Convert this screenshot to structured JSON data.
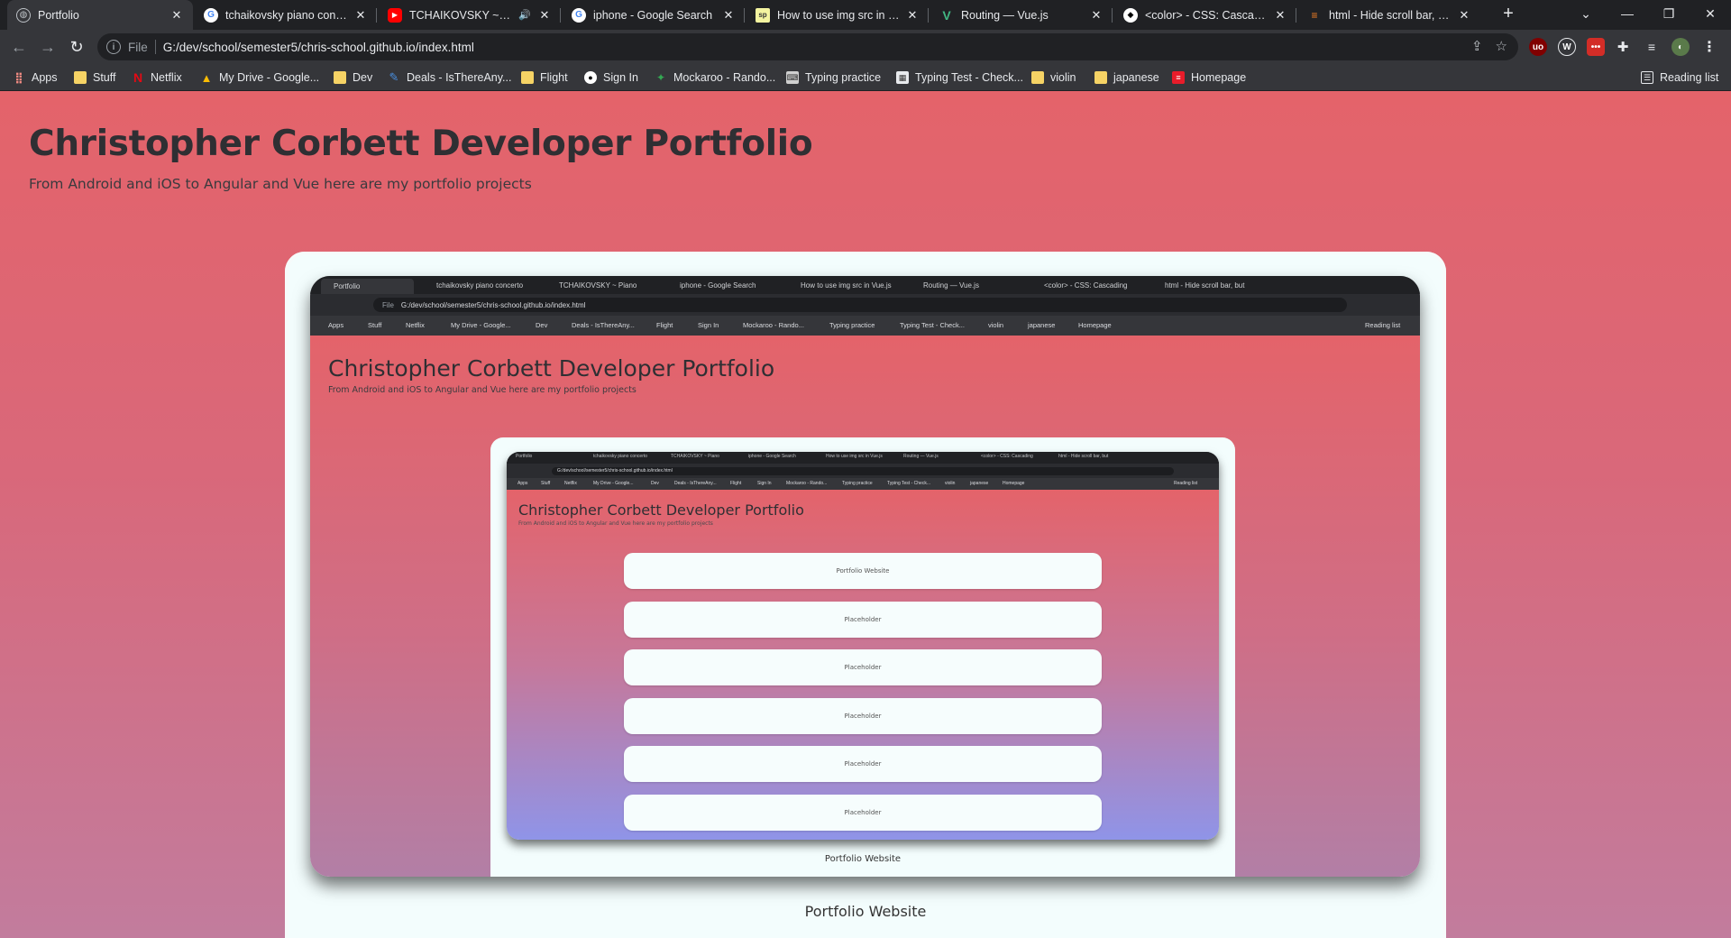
{
  "browser": {
    "tabs": [
      {
        "title": "Portfolio",
        "icon": "globe-icon",
        "active": true
      },
      {
        "title": "tchaikovsky piano concerto",
        "icon": "google-icon"
      },
      {
        "title": "TCHAIKOVSKY ~ Piano",
        "icon": "youtube-icon",
        "audio": true
      },
      {
        "title": "iphone - Google Search",
        "icon": "google-icon"
      },
      {
        "title": "How to use img src in Vue.js",
        "icon": "sitepoint-icon"
      },
      {
        "title": "Routing — Vue.js",
        "icon": "vue-icon"
      },
      {
        "title": "<color> - CSS: Cascading",
        "icon": "mdn-icon"
      },
      {
        "title": "html - Hide scroll bar, but",
        "icon": "stackoverflow-icon"
      }
    ],
    "new_tab_label": "+",
    "address": {
      "scheme_label": "File",
      "url": "G:/dev/school/semester5/chris-school.github.io/index.html"
    },
    "bookmarks": [
      {
        "label": "Apps",
        "icon": "apps-grid-icon"
      },
      {
        "label": "Stuff",
        "icon": "folder-icon"
      },
      {
        "label": "Netflix",
        "icon": "netflix-icon"
      },
      {
        "label": "My Drive - Google...",
        "icon": "google-drive-icon"
      },
      {
        "label": "Dev",
        "icon": "folder-icon"
      },
      {
        "label": "Deals - IsThereAny...",
        "icon": "deals-icon"
      },
      {
        "label": "Flight",
        "icon": "folder-icon"
      },
      {
        "label": "Sign In",
        "icon": "github-icon"
      },
      {
        "label": "Mockaroo - Rando...",
        "icon": "mockaroo-icon"
      },
      {
        "label": "Typing practice",
        "icon": "typing-icon"
      },
      {
        "label": "Typing Test - Check...",
        "icon": "keyboard-icon"
      },
      {
        "label": "violin",
        "icon": "folder-icon"
      },
      {
        "label": "japanese",
        "icon": "folder-icon"
      },
      {
        "label": "Homepage",
        "icon": "homepage-icon"
      }
    ],
    "reading_list_label": "Reading list"
  },
  "page": {
    "title": "Christopher Corbett Developer Portfolio",
    "subtitle": "From Android and iOS to Angular and Vue here are my portfolio projects",
    "project_card": {
      "caption": "Portfolio Website",
      "screenshot": {
        "title": "Christopher Corbett Developer Portfolio",
        "subtitle": "From Android and iOS to Angular and Vue here are my portfolio projects",
        "caption": "Portfolio Website",
        "inner_buttons": [
          "Portfolio Website",
          "Placeholder",
          "Placeholder",
          "Placeholder",
          "Placeholder",
          "Placeholder"
        ]
      }
    }
  },
  "colors": {
    "page_gradient_top": "#e4636a",
    "page_gradient_bottom": "#c27c9d",
    "card_background": "#f3fdfd",
    "chrome_dark": "#202124",
    "chrome_toolbar": "#35363a"
  }
}
